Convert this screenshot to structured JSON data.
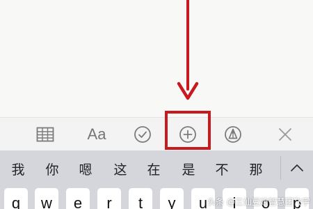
{
  "colors": {
    "annotation_red": "#c8191f",
    "toolbar_icon": "#7b7b7b",
    "keyboard_bg": "#d4d6dc"
  },
  "toolbar": {
    "buttons": [
      {
        "name": "table",
        "icon": "table-icon"
      },
      {
        "name": "text-format",
        "label": "Aa",
        "icon": "text-format-icon"
      },
      {
        "name": "checklist",
        "icon": "checkmark-circle-icon"
      },
      {
        "name": "add",
        "icon": "plus-circle-icon",
        "highlighted": true
      },
      {
        "name": "markup",
        "icon": "pen-circle-icon"
      },
      {
        "name": "close",
        "icon": "close-icon"
      }
    ]
  },
  "candidates": [
    "我",
    "你",
    "嗯",
    "这",
    "在",
    "是",
    "不",
    "那"
  ],
  "keys_row1": [
    "q",
    "w",
    "e",
    "r",
    "t",
    "y",
    "u",
    "i",
    "o",
    "p"
  ],
  "watermark": "头条 @三仙豆娘智慧团飞宇"
}
